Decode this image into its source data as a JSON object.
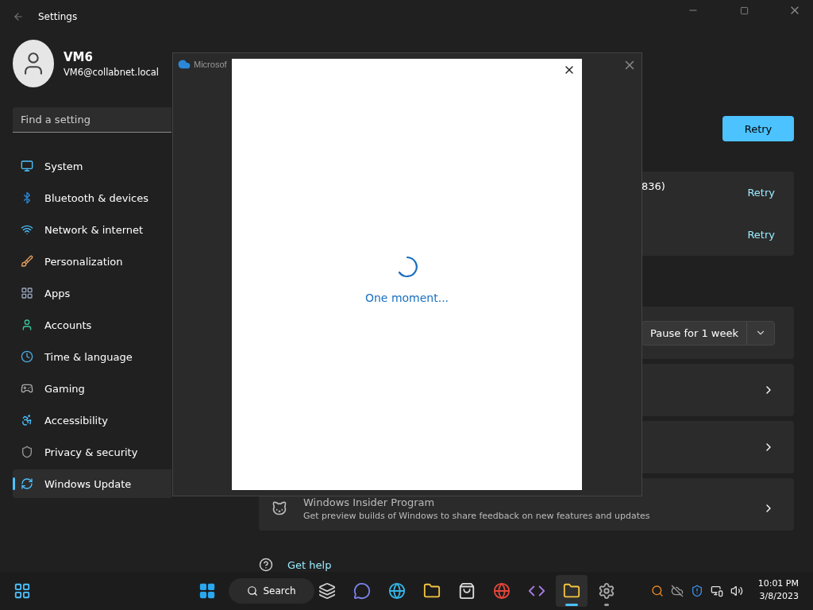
{
  "window": {
    "title": "Settings"
  },
  "user": {
    "name": "VM6",
    "email": "VM6@collabnet.local"
  },
  "search": {
    "placeholder": "Find a setting"
  },
  "sidebar": {
    "items": [
      {
        "label": "System",
        "selected": false
      },
      {
        "label": "Bluetooth & devices",
        "selected": false
      },
      {
        "label": "Network & internet",
        "selected": false
      },
      {
        "label": "Personalization",
        "selected": false
      },
      {
        "label": "Apps",
        "selected": false
      },
      {
        "label": "Accounts",
        "selected": false
      },
      {
        "label": "Time & language",
        "selected": false
      },
      {
        "label": "Gaming",
        "selected": false
      },
      {
        "label": "Accessibility",
        "selected": false
      },
      {
        "label": "Privacy & security",
        "selected": false
      },
      {
        "label": "Windows Update",
        "selected": true
      }
    ]
  },
  "main": {
    "primary_button": "Retry",
    "failed_updates": [
      {
        "title": "836)",
        "action": "Retry"
      },
      {
        "action": "Retry"
      }
    ],
    "pause": {
      "label": "Pause for 1 week"
    },
    "cards": [
      {
        "kind": "link"
      },
      {
        "kind": "link"
      },
      {
        "kind": "insider",
        "title": "Windows Insider Program",
        "description": "Get preview builds of Windows to share feedback on new features and updates"
      }
    ],
    "help": "Get help"
  },
  "dialog": {
    "title": "Microsof",
    "message": "One moment..."
  },
  "taskbar": {
    "search": "Search",
    "apps": [
      {
        "kind": "taskview",
        "active": false,
        "running": false
      },
      {
        "kind": "chat",
        "active": false,
        "running": false
      },
      {
        "kind": "edge",
        "active": false,
        "running": false
      },
      {
        "kind": "explorer",
        "active": false,
        "running": false
      },
      {
        "kind": "store",
        "active": false,
        "running": false
      },
      {
        "kind": "chrome",
        "active": false,
        "running": false
      },
      {
        "kind": "studio",
        "active": false,
        "running": false
      },
      {
        "kind": "onedrive",
        "active": true,
        "running": true
      },
      {
        "kind": "settings",
        "active": false,
        "running": true
      }
    ],
    "clock": {
      "time": "10:01 PM",
      "date": "3/8/2023"
    }
  }
}
